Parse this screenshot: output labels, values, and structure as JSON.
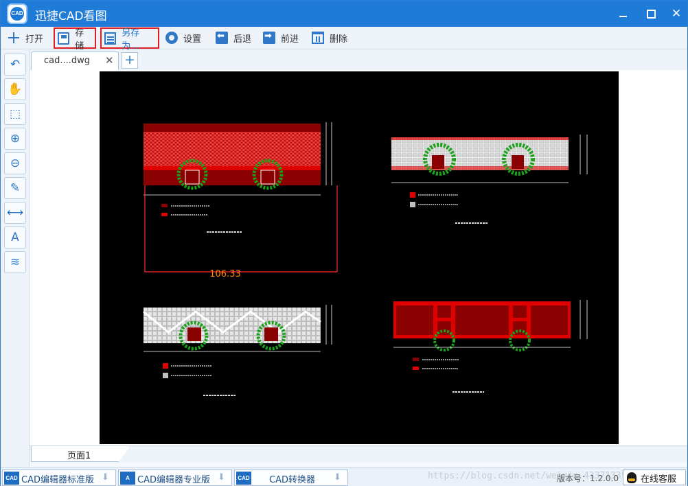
{
  "window": {
    "title": "迅捷CAD看图",
    "logo_text": "CAD"
  },
  "toolbar": {
    "open_label": "打开",
    "save_label": "存储",
    "saveas_label": "另存为...",
    "settings_label": "设置",
    "back_label": "后退",
    "forward_label": "前进",
    "delete_label": "删除"
  },
  "tools": [
    {
      "name": "zoom-back-icon"
    },
    {
      "name": "pan-hand-icon"
    },
    {
      "name": "zoom-window-icon"
    },
    {
      "name": "zoom-in-icon"
    },
    {
      "name": "zoom-out-icon"
    },
    {
      "name": "pen-icon"
    },
    {
      "name": "measure-icon"
    },
    {
      "name": "text-icon",
      "glyph": "A"
    },
    {
      "name": "layers-icon"
    }
  ],
  "tabs": {
    "file_label": "cad....dwg",
    "close_glyph": "✕",
    "add_glyph": "+"
  },
  "drawing": {
    "dimension_value": "106.33",
    "colors": {
      "dark_red": "#8b0000",
      "red": "#e00000",
      "green": "#1aa31a",
      "white": "#ffffff",
      "orange": "#ff8a00",
      "grey": "#bfbfbf"
    }
  },
  "pages": {
    "page1_label": "页面1"
  },
  "status": {
    "products": [
      {
        "icon": "CAD",
        "label": "CAD编辑器标准版"
      },
      {
        "icon": "A",
        "label": "CAD编辑器专业版"
      },
      {
        "icon": "CAD",
        "label": "CAD转换器"
      }
    ],
    "watermark": "https://blog.csdn.net/weixin_43371335",
    "version": "版本号：1.2.0.0",
    "support_label": "在线客服"
  }
}
